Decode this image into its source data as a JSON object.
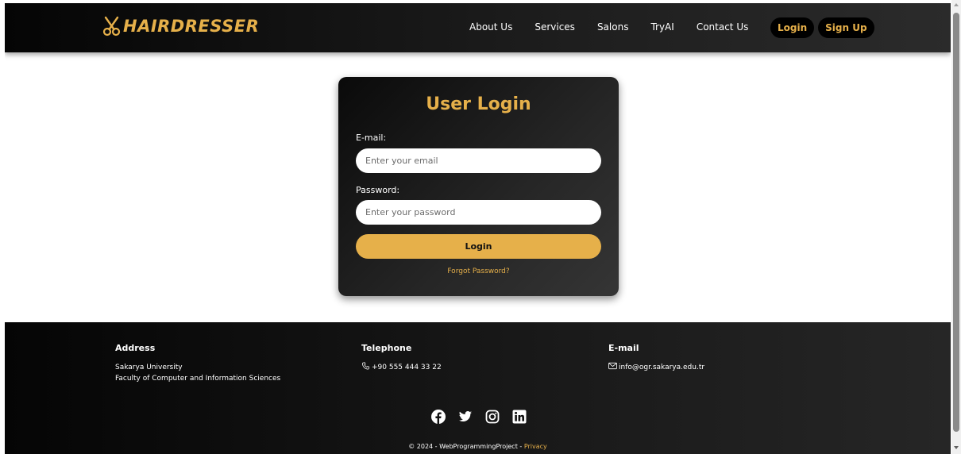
{
  "colors": {
    "accent": "#e6b04a",
    "dark": "#0a0a0a"
  },
  "navbar": {
    "brand": "HAIRDRESSER",
    "brand_icon": "scissors-icon",
    "links": [
      "About Us",
      "Services",
      "Salons",
      "TryAI",
      "Contact Us"
    ],
    "login": "Login",
    "signup": "Sign Up"
  },
  "login_card": {
    "title": "User Login",
    "email_label": "E-mail:",
    "email_placeholder": "Enter your email",
    "password_label": "Password:",
    "password_placeholder": "Enter your password",
    "submit": "Login",
    "forgot": "Forgot Password?"
  },
  "footer": {
    "address": {
      "title": "Address",
      "line1": "Sakarya University",
      "line2": "Faculty of Computer and Information Sciences"
    },
    "telephone": {
      "title": "Telephone",
      "value": "+90 555 444 33 22",
      "icon": "phone-icon"
    },
    "email": {
      "title": "E-mail",
      "value": "info@ogr.sakarya.edu.tr",
      "icon": "envelope-icon"
    },
    "socials": [
      "facebook-icon",
      "twitter-icon",
      "instagram-icon",
      "linkedin-icon"
    ],
    "copyright": "© 2024 - WebProgrammingProject -",
    "privacy": "Privacy"
  }
}
